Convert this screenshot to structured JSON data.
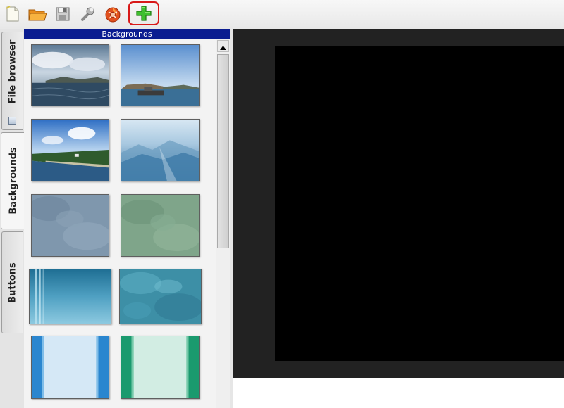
{
  "toolbar": {
    "buttons": [
      {
        "id": "new",
        "icon": "new-document-icon"
      },
      {
        "id": "open",
        "icon": "open-folder-icon"
      },
      {
        "id": "save",
        "icon": "save-disk-icon"
      },
      {
        "id": "settings",
        "icon": "wrench-icon"
      },
      {
        "id": "burn",
        "icon": "burn-disc-icon"
      },
      {
        "id": "add",
        "icon": "add-plus-icon",
        "highlighted": true
      }
    ],
    "highlight_color": "#d81818"
  },
  "side_tabs": {
    "file_browser": {
      "label": "File browser",
      "icon": "folder-icon"
    },
    "backgrounds": {
      "label": "Backgrounds",
      "active": true
    },
    "buttons": {
      "label": "Buttons"
    }
  },
  "panel": {
    "title": "Backgrounds",
    "header_color": "#0a1c90",
    "thumbnails": [
      {
        "name": "sea-clouds",
        "description_icon": "seascape-thumbnail"
      },
      {
        "name": "island-ship",
        "description_icon": "island-thumbnail"
      },
      {
        "name": "lakeshore",
        "description_icon": "lakeshore-thumbnail"
      },
      {
        "name": "blue-mountains",
        "description_icon": "mountains-thumbnail"
      },
      {
        "name": "blue-gray-texture",
        "description_icon": "texture-thumbnail"
      },
      {
        "name": "green-texture",
        "description_icon": "texture-thumbnail"
      },
      {
        "name": "teal-stripes",
        "description_icon": "stripes-thumbnail"
      },
      {
        "name": "aqua-marble",
        "description_icon": "marble-thumbnail"
      },
      {
        "name": "blue-border",
        "description_icon": "border-thumbnail"
      },
      {
        "name": "green-border",
        "description_icon": "border-thumbnail"
      }
    ]
  },
  "preview": {
    "background": "#000000"
  }
}
